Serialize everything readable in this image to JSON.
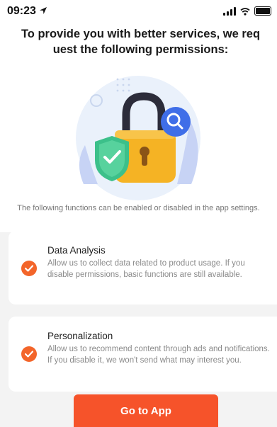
{
  "status_bar": {
    "time": "09:23",
    "icons": [
      "location-arrow-icon",
      "signal-icon",
      "wifi-icon",
      "battery-icon"
    ]
  },
  "header": {
    "title": "To provide you with better services, we request the following permissions:"
  },
  "illustration": {
    "icons": [
      "lock-icon",
      "shield-check-icon",
      "search-icon"
    ]
  },
  "subtitle": "The following functions can be enabled or disabled in the app settings.",
  "permissions": [
    {
      "title": "Data Analysis",
      "description": "Allow us to collect data related to product usage. If you disable permissions, basic functions are still available.",
      "icon": "check-icon"
    },
    {
      "title": "Personalization",
      "description": "Allow us to recommend content through ads and notifications. If you disable it, we won't send what may interest you.",
      "icon": "check-icon"
    }
  ],
  "actions": {
    "go_label": "Go to App"
  },
  "colors": {
    "accent": "#f6532a",
    "check": "#f3652a",
    "lock_body": "#f5b324",
    "shield": "#3cc08a",
    "search_badge": "#3f6ee8"
  }
}
